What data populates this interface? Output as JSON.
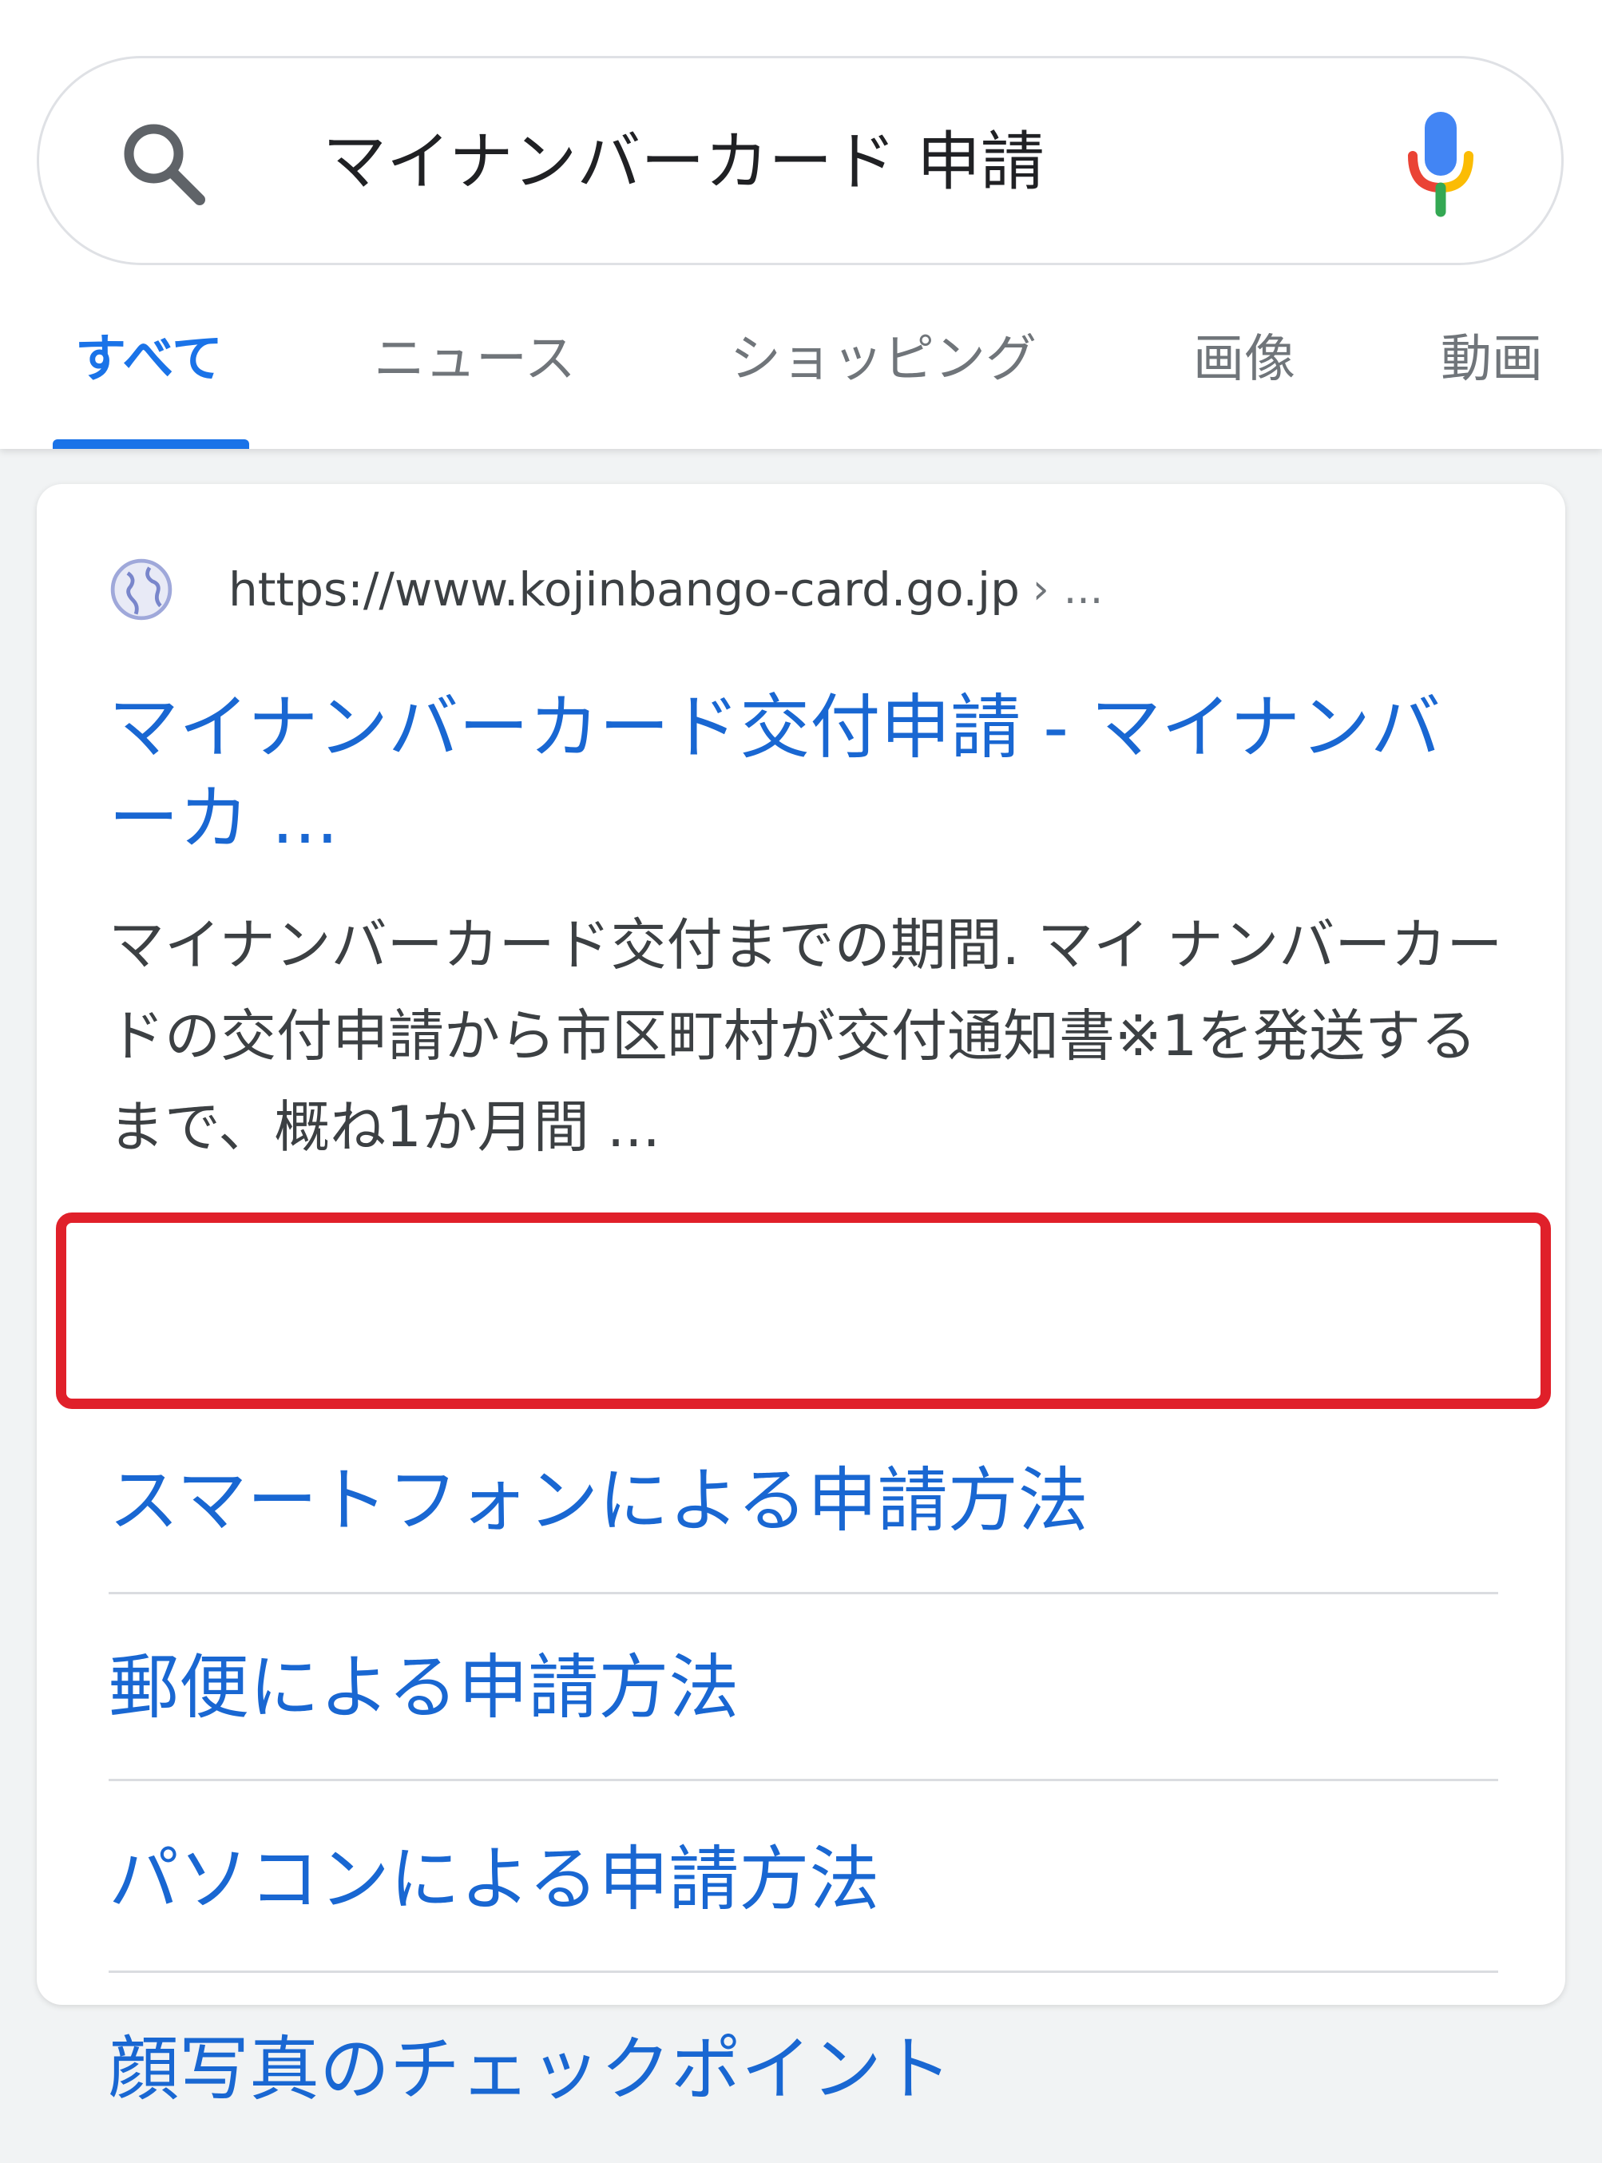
{
  "search": {
    "query": "マイナンバーカード 申請"
  },
  "tabs": [
    {
      "label": "すべて",
      "active": true
    },
    {
      "label": "ニュース",
      "active": false
    },
    {
      "label": "ショッピング",
      "active": false
    },
    {
      "label": "画像",
      "active": false
    },
    {
      "label": "動画",
      "active": false
    }
  ],
  "result": {
    "url": "https://www.kojinbango-card.go.jp",
    "url_suffix": "›",
    "url_ellipsis": "...",
    "title": "マイナンバーカード交付申請 - マイナンバーカ ...",
    "snippet": "マイナンバーカード交付までの期間. マイ ナンバーカードの交付申請から市区町村が交付通知書※1を発送するまで、概ね1か月間 ...",
    "sitelinks": [
      {
        "label": "スマートフォンによる申請方法",
        "highlighted": true
      },
      {
        "label": "郵便による申請方法",
        "highlighted": false
      },
      {
        "label": "パソコンによる申請方法",
        "highlighted": false
      },
      {
        "label": "顔写真のチェックポイント",
        "highlighted": false
      }
    ]
  },
  "colors": {
    "link_blue": "#1967d2",
    "tab_active": "#1a73e8",
    "highlight_red": "#e0202a"
  },
  "icons": {
    "search": "search-icon",
    "mic": "mic-icon",
    "globe": "globe-icon"
  }
}
